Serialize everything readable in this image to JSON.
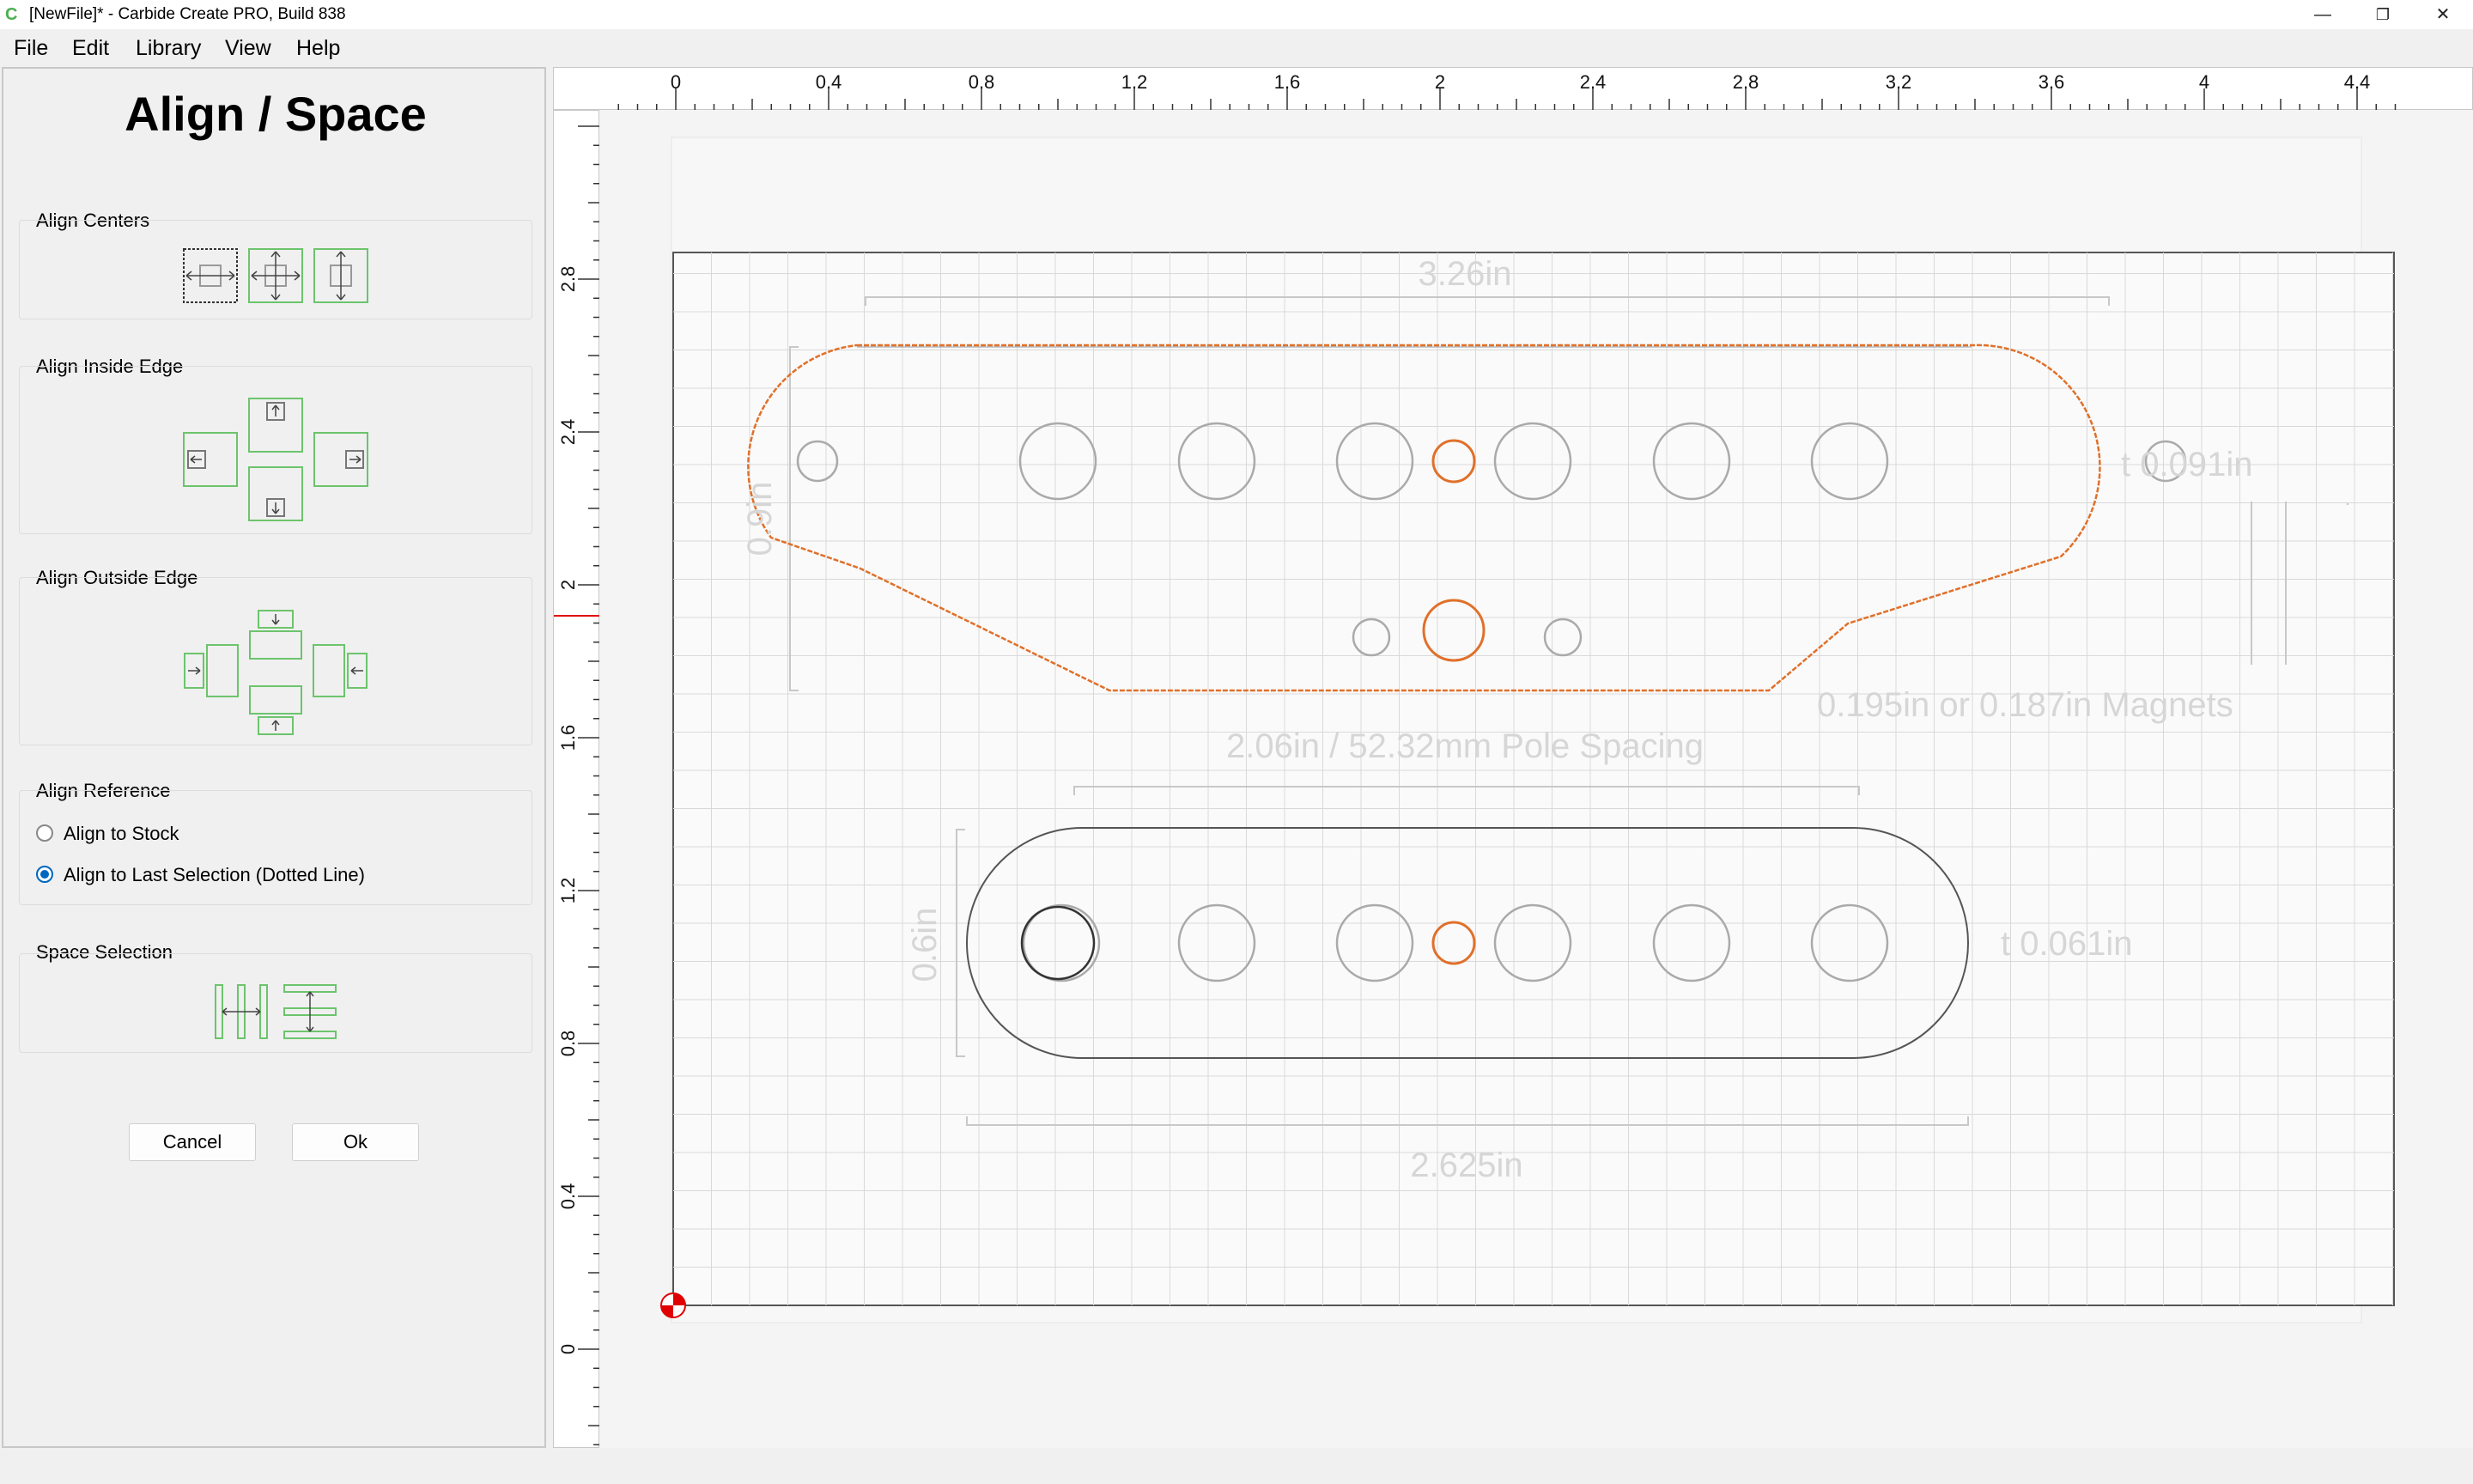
{
  "window": {
    "title": "[NewFile]* - Carbide Create PRO, Build 838",
    "app_icon": "carbide-c-icon",
    "minimize": "—",
    "restore": "❐",
    "close": "✕"
  },
  "menu": {
    "file": "File",
    "edit": "Edit",
    "library": "Library",
    "view": "View",
    "help": "Help"
  },
  "panel": {
    "title": "Align / Space",
    "align_centers": "Align Centers",
    "align_inside_edge": "Align Inside Edge",
    "align_outside_edge": "Align Outside Edge",
    "align_reference": "Align Reference",
    "align_to_stock": "Align to Stock",
    "align_to_last": "Align to Last Selection (Dotted Line)",
    "space_selection": "Space Selection",
    "cancel": "Cancel",
    "ok": "Ok",
    "selected_reference": "last"
  },
  "rulers": {
    "horizontal": [
      "0",
      "0.4",
      "0.8",
      "1.2",
      "1.6",
      "2",
      "2.4",
      "2.8",
      "3.2",
      "3.6",
      "4",
      "4.4"
    ],
    "vertical": [
      "2.8",
      "2.4",
      "2",
      "1.6",
      "1.2",
      "0.8",
      "0.4",
      "0"
    ]
  },
  "drawing": {
    "dim_top_width": "3.26in",
    "dim_top_height": "0.9in",
    "dim_top_thickness": "t 0.091in",
    "dim_magnets": "0.195in or 0.187in Magnets",
    "dim_pole_spacing": "2.06in / 52.32mm Pole Spacing",
    "dim_bottom_height": "0.6in",
    "dim_bottom_thickness": "t 0.061in",
    "dim_bottom_width": "2.625in"
  },
  "colors": {
    "selection_orange": "#e0702a",
    "icon_green": "#6cc46c",
    "grid": "#d9d9d9",
    "origin_red": "#e00000"
  }
}
